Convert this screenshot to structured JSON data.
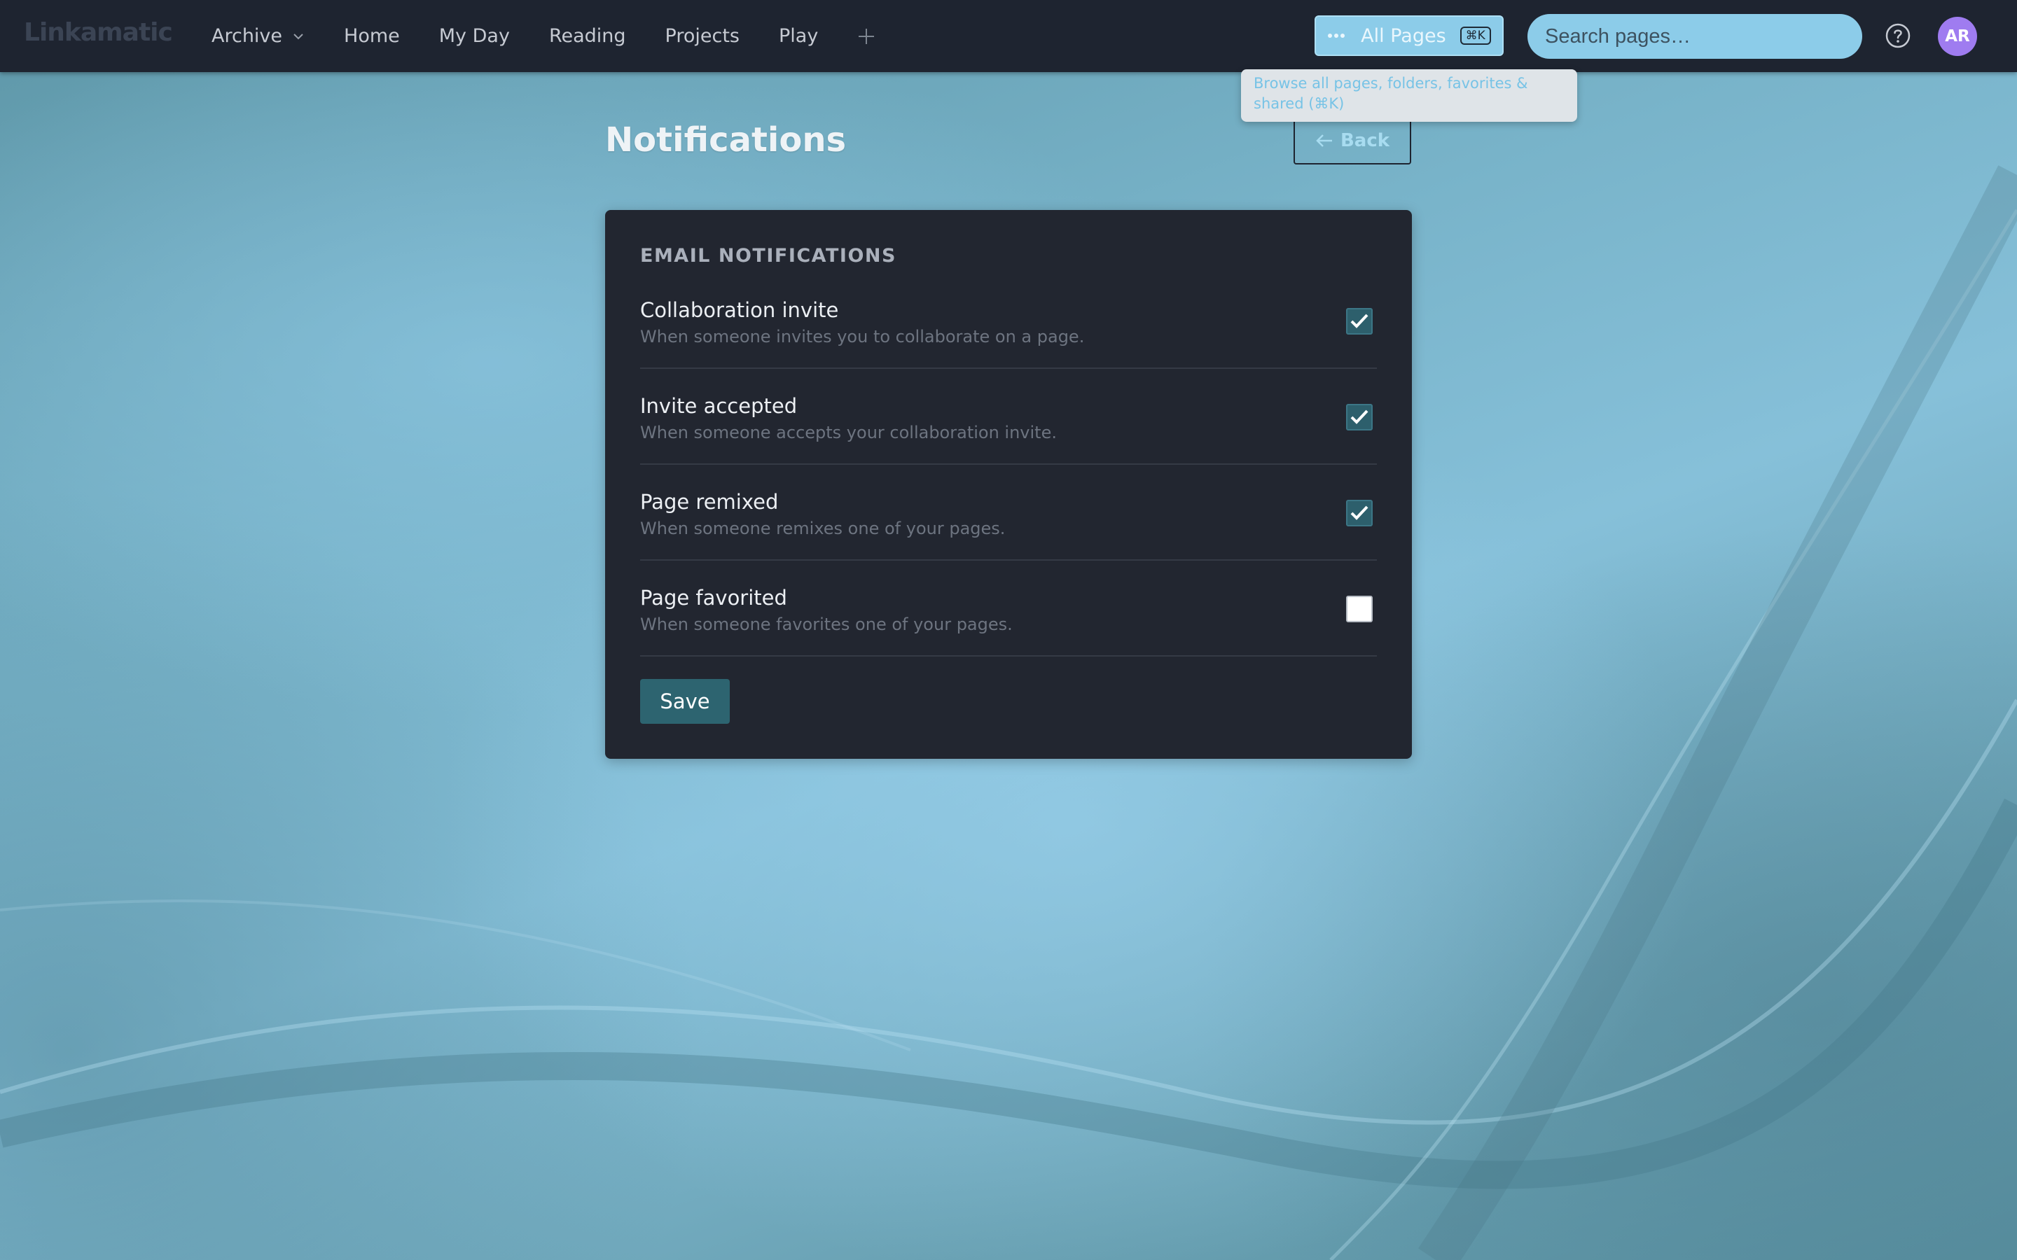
{
  "app": {
    "logo": "Linkamatic"
  },
  "nav": {
    "archive_label": "Archive",
    "items": [
      "Home",
      "My Day",
      "Reading",
      "Projects",
      "Play"
    ]
  },
  "header": {
    "all_pages_label": "All Pages",
    "all_pages_shortcut": "⌘K",
    "search_placeholder": "Search pages…",
    "avatar_initials": "AR"
  },
  "tooltip": {
    "text": "Browse all pages, folders, favorites & shared (⌘K)"
  },
  "page": {
    "title": "Notifications",
    "back_label": "Back"
  },
  "email_notifications": {
    "section_title": "EMAIL NOTIFICATIONS",
    "items": [
      {
        "label": "Collaboration invite",
        "description": "When someone invites you to collaborate on a page.",
        "checked": true
      },
      {
        "label": "Invite accepted",
        "description": "When someone accepts your collaboration invite.",
        "checked": true
      },
      {
        "label": "Page remixed",
        "description": "When someone remixes one of your pages.",
        "checked": true
      },
      {
        "label": "Page favorited",
        "description": "When someone favorites one of your pages.",
        "checked": false
      }
    ],
    "save_label": "Save"
  },
  "colors": {
    "topbar": "#1e2430",
    "card": "#222630",
    "accent": "#2d6470",
    "highlight": "#8ccce9",
    "avatar": "#9f7cf0"
  }
}
